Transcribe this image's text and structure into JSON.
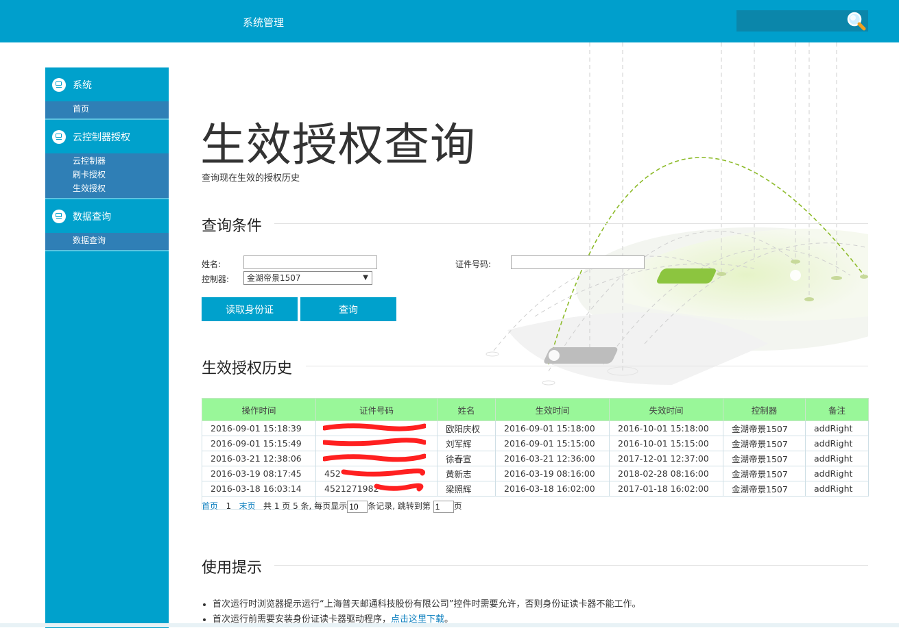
{
  "header": {
    "title": "系统管理",
    "search_placeholder": "",
    "search_icon": "magnifier-icon"
  },
  "sidebar": {
    "groups": [
      {
        "title": "系统",
        "items": [
          "首页"
        ]
      },
      {
        "title": "云控制器授权",
        "items": [
          "云控制器",
          "刷卡授权",
          "生效授权"
        ]
      },
      {
        "title": "数据查询",
        "items": [
          "数据查询"
        ]
      }
    ]
  },
  "page": {
    "title": "生效授权查询",
    "description": "查询现在生效的授权历史"
  },
  "query": {
    "section_title": "查询条件",
    "name_label": "姓名:",
    "name_value": "",
    "id_label": "证件号码:",
    "id_value": "",
    "controller_label": "控制器:",
    "controller_value": "金湖帝景1507",
    "read_id_button": "读取身份证",
    "search_button": "查询"
  },
  "history": {
    "section_title": "生效授权历史",
    "columns": [
      "操作时间",
      "证件号码",
      "姓名",
      "生效时间",
      "失效时间",
      "控制器",
      "备注"
    ],
    "rows": [
      [
        "2016-09-01 15:18:39",
        "",
        "欧阳庆权",
        "2016-09-01 15:18:00",
        "2016-10-01 15:18:00",
        "金湖帝景1507",
        "addRight"
      ],
      [
        "2016-09-01 15:15:49",
        "",
        "刘军辉",
        "2016-09-01 15:15:00",
        "2016-10-01 15:15:00",
        "金湖帝景1507",
        "addRight"
      ],
      [
        "2016-03-21 12:38:06",
        "",
        "徐春宣",
        "2016-03-21 12:36:00",
        "2017-12-01 12:37:00",
        "金湖帝景1507",
        "addRight"
      ],
      [
        "2016-03-19 08:17:45",
        "452",
        "黄新志",
        "2016-03-19 08:16:00",
        "2018-02-28 08:16:00",
        "金湖帝景1507",
        "addRight"
      ],
      [
        "2016-03-18 16:03:14",
        "4521271982",
        "梁照辉",
        "2016-03-18 16:02:00",
        "2017-01-18 16:02:00",
        "金湖帝景1507",
        "addRight"
      ]
    ]
  },
  "pager": {
    "first": "首页",
    "current": "1",
    "last": "末页",
    "summary": "共 1 页 5 条, 每页显示",
    "page_size": "10",
    "jump_text": "条记录, 跳转到第",
    "jump_value": "1",
    "page_suffix": "页"
  },
  "tips": {
    "section_title": "使用提示",
    "items": [
      "首次运行时浏览器提示运行“上海普天邮通科技股份有限公司”控件时需要允许，否则身份证读卡器不能工作。",
      "首次运行前需要安装身份证读卡器驱动程序，"
    ],
    "download_link": "点击这里下载",
    "download_suffix": "。"
  },
  "colors": {
    "header": "#009fcc",
    "sidebar": "#00a1cc",
    "submenu": "#2f7fb6",
    "table_header": "#99f799",
    "link": "#0c7fbf",
    "redaction": "#ff2020"
  }
}
